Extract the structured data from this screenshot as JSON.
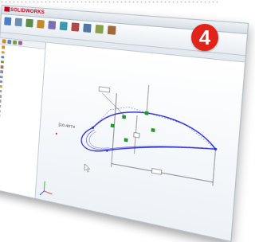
{
  "app": {
    "brand": "SOLIDWORKS",
    "brand_color": "#c4001a"
  },
  "ribbon": {
    "buttons": [
      {
        "icon": "sketch-icon",
        "color": "#4a7fc1"
      },
      {
        "icon": "smart-dimension-icon",
        "color": "#6a8fb3"
      },
      {
        "icon": "line-icon",
        "color": "#5d8d4a"
      },
      {
        "icon": "rectangle-icon",
        "color": "#c48a2a"
      },
      {
        "icon": "circle-icon",
        "color": "#7a6fb0"
      },
      {
        "icon": "spline-icon",
        "color": "#3c9ab0"
      },
      {
        "icon": "trim-icon",
        "color": "#b04a4a"
      },
      {
        "icon": "mirror-icon",
        "color": "#5078a8"
      },
      {
        "icon": "pattern-icon",
        "color": "#8aa04a"
      },
      {
        "icon": "relations-icon",
        "color": "#a06a3c"
      }
    ]
  },
  "tabs": [],
  "feature_manager": {
    "tools": [
      {
        "icon": "feature-tree-icon",
        "color": "#d08a2a"
      },
      {
        "icon": "property-manager-icon",
        "color": "#5a86b8"
      },
      {
        "icon": "configuration-icon",
        "color": "#7a9a4a"
      },
      {
        "icon": "display-manager-icon",
        "color": "#a05aa0"
      }
    ],
    "items": [
      {
        "label": "",
        "icon_color": "#d08a2a"
      },
      {
        "label": "",
        "icon_color": "#c9a23a"
      },
      {
        "label": "",
        "icon_color": "#5a86b8"
      },
      {
        "label": "",
        "icon_color": "#7a9a4a"
      },
      {
        "label": "",
        "icon_color": "#a07a4a"
      },
      {
        "label": "",
        "icon_color": "#8a8fb8"
      },
      {
        "label": "",
        "icon_color": "#8a8fb8"
      },
      {
        "label": "",
        "icon_color": "#8a8fb8"
      },
      {
        "label": "",
        "icon_color": "#c9a23a"
      },
      {
        "label": "",
        "icon_color": "#9aa3ab",
        "grey": true
      },
      {
        "label": "",
        "icon_color": "#9aa3ab",
        "grey": true
      },
      {
        "label": "",
        "icon_color": "#9aa3ab",
        "grey": true
      },
      {
        "label": "",
        "icon_color": "#9aa3ab",
        "grey": true
      },
      {
        "label": "",
        "icon_color": "#9aa3ab",
        "grey": true
      },
      {
        "label": "",
        "icon_color": "#9aa3ab",
        "grey": true
      },
      {
        "label": "",
        "icon_color": "#9aa3ab",
        "grey": true
      },
      {
        "label": "",
        "icon_color": "#9aa3ab",
        "grey": true
      },
      {
        "label": "",
        "icon_color": "#9aa3ab",
        "grey": true
      },
      {
        "label": "",
        "icon_color": "#9aa3ab",
        "grey": true
      },
      {
        "label": "",
        "icon_color": "#9aa3ab",
        "grey": true
      },
      {
        "label": "",
        "icon_color": "#9aa3ab",
        "grey": true
      },
      {
        "label": "",
        "icon_color": "#9aa3ab",
        "grey": true
      },
      {
        "label": "",
        "icon_color": "#9aa3ab",
        "grey": true
      },
      {
        "label": "",
        "icon_color": "#9aa3ab",
        "grey": true
      },
      {
        "label": "",
        "icon_color": "#9aa3ab",
        "grey": true
      },
      {
        "label": "",
        "icon_color": "#9aa3ab",
        "grey": true
      },
      {
        "label": "",
        "icon_color": "#9aa3ab",
        "grey": true
      },
      {
        "label": "",
        "icon_color": "#9aa3ab",
        "grey": true
      }
    ]
  },
  "viewport": {
    "dimension_label": "[10.4074",
    "sketch_color": "#2a2ad0",
    "dimension_color": "#333333",
    "point_color": "#1f9a2a",
    "axis_colors": {
      "x": "#d02020",
      "y": "#20a020",
      "z": "#2040d0"
    }
  },
  "badge": {
    "text": "4",
    "color": "#e2231a"
  }
}
